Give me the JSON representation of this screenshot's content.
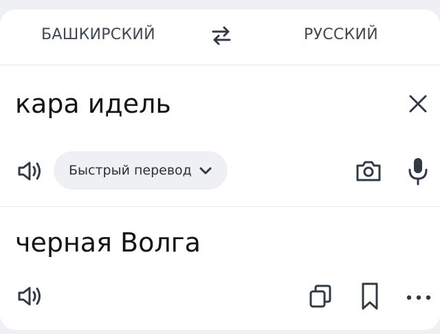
{
  "languages": {
    "source": "БАШКИРСКИЙ",
    "target": "РУССКИЙ"
  },
  "source": {
    "text": "кара идель"
  },
  "mode_chip": {
    "label": "Быстрый перевод"
  },
  "result": {
    "text": "черная Волга"
  },
  "colors": {
    "icon": "#2f3a44",
    "text": "#111418",
    "chip_bg": "#eef0f3",
    "divider": "#e6e8ec"
  },
  "icons": {
    "swap": "swap-languages-icon",
    "clear": "close-icon",
    "speak": "speaker-icon",
    "chevron": "chevron-down-icon",
    "camera": "camera-icon",
    "microphone": "microphone-icon",
    "copy": "copy-icon",
    "bookmark": "bookmark-icon",
    "more": "more-icon"
  }
}
